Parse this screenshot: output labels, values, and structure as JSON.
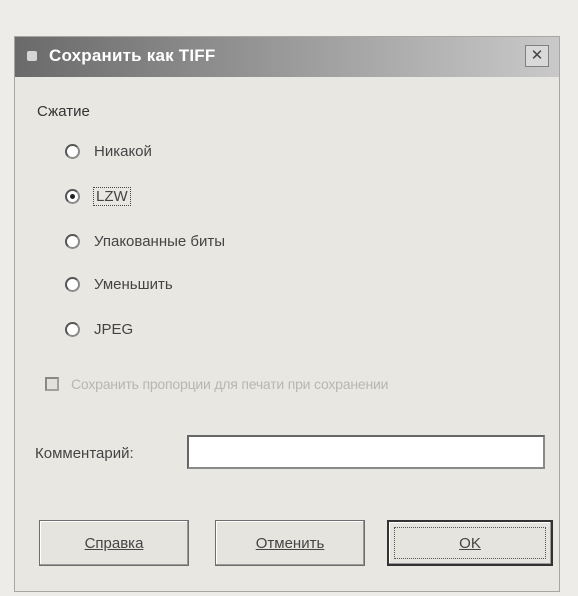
{
  "dialog": {
    "title": "Сохранить как TIFF",
    "close_glyph": "✕"
  },
  "compression": {
    "label": "Сжатие",
    "options": [
      {
        "label": "Никакой",
        "checked": false
      },
      {
        "label": "LZW",
        "checked": true
      },
      {
        "label": "Упакованные биты",
        "checked": false
      },
      {
        "label": "Уменьшить",
        "checked": false
      },
      {
        "label": "JPEG",
        "checked": false
      }
    ]
  },
  "option_checkbox": {
    "label": "Сохранить пропорции для печати при сохранении",
    "checked": false,
    "disabled": true
  },
  "comment": {
    "label": "Комментарий:",
    "value": ""
  },
  "buttons": {
    "help": "Справка",
    "cancel": "Отменить",
    "ok": "OK"
  },
  "icons": {
    "title": "app-icon",
    "close": "close-icon"
  }
}
